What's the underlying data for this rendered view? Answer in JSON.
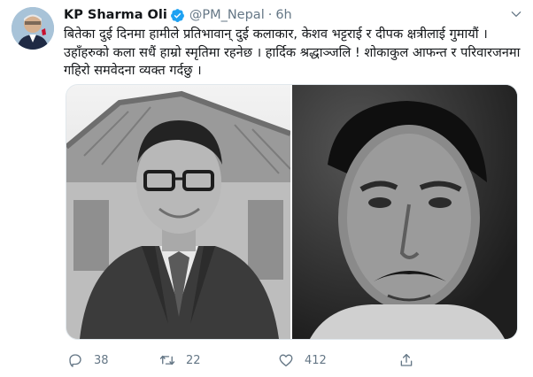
{
  "tweet": {
    "author": {
      "display_name": "KP Sharma Oli",
      "verified": true,
      "handle": "@PM_Nepal",
      "separator": "·",
      "time": "6h"
    },
    "text": "बितेका दुई दिनमा हामीले प्रतिभावान् दुई कलाकार, केशव भट्टराई र दीपक क्षत्रीलाई गुमायौं । उहाँहरुको कला सधैं हाम्रो स्मृतिमा रहनेछ । हार्दिक श्रद्धाञ्जलि ! शोकाकुल आफन्त र परिवारजनमा गहिरो समवेदना व्यक्त गर्दछु ।",
    "media": [
      {
        "kind": "photo",
        "style": "black-and-white portrait, man with glasses and suit"
      },
      {
        "kind": "photo",
        "style": "black-and-white portrait, man with mustache"
      }
    ],
    "actions": {
      "reply_count": "38",
      "retweet_count": "22",
      "like_count": "412"
    }
  },
  "icons": [
    "verified-icon",
    "caret-down-icon",
    "reply-icon",
    "retweet-icon",
    "like-icon",
    "share-icon"
  ],
  "colors": {
    "text": "#14171a",
    "secondary": "#657786",
    "verified": "#1da1f2"
  }
}
